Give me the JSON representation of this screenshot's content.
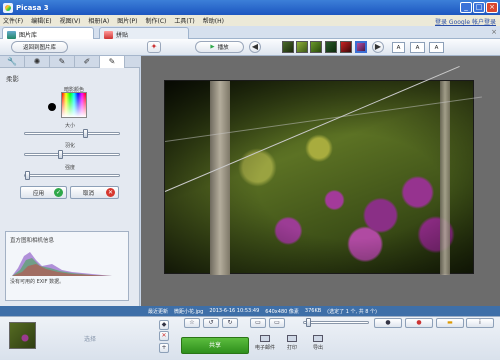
{
  "window": {
    "title": "Picasa 3",
    "min": "_",
    "max": "□",
    "close": "×"
  },
  "menu": {
    "items": [
      "文件(F)",
      "编辑(E)",
      "视图(V)",
      "相册(A)",
      "图片(P)",
      "制作(C)",
      "工具(T)",
      "帮助(H)"
    ],
    "login": "登录 Google 帐户登录"
  },
  "tabs": [
    {
      "label": "图片库"
    },
    {
      "label": "拼贴"
    }
  ],
  "tabs_close": "×",
  "toolbar": {
    "back_label": "返回到图片库",
    "play_label": "播放",
    "play_icon": "▶",
    "nav_prev": "◀",
    "nav_next": "▶",
    "text_buttons": [
      "A",
      "A",
      "A"
    ],
    "prev_arrow_hint": "←",
    "next_arrow_hint": "→"
  },
  "panel": {
    "tool_tabs": [
      "🔧",
      "✺",
      "✎",
      "✐",
      "✎"
    ],
    "heading": "柔影",
    "color_label": "暗影颜色",
    "sliders": [
      {
        "label": "大小",
        "value": 0.62
      },
      {
        "label": "羽化",
        "value": 0.35
      },
      {
        "label": "强度",
        "value": 0.02
      }
    ],
    "apply_label": "应用",
    "apply_icon": "✓",
    "cancel_label": "取消",
    "cancel_icon": "✕",
    "histogram_title": "直方图和相机信息",
    "exif_note": "没有可用的 EXIF 数据。"
  },
  "status": {
    "items": [
      "最近更新",
      "微距小花.jpg",
      "2013-6-16 10:53:49",
      "640x480 像素",
      "376KB"
    ],
    "count": "(选定了 1 个, 共 8 个)"
  },
  "bottom": {
    "tray_label": "选择",
    "share_label": "共享",
    "actions": [
      "电子邮件",
      "打印",
      "导出"
    ],
    "rotate_left": "↺",
    "rotate_right": "↻",
    "star": "☆",
    "pin": "◆",
    "info": "i"
  },
  "colors": {
    "status_bar": "#3e6fa8",
    "share_button": "#3fa22a",
    "titlebar": "#2a63c9"
  }
}
